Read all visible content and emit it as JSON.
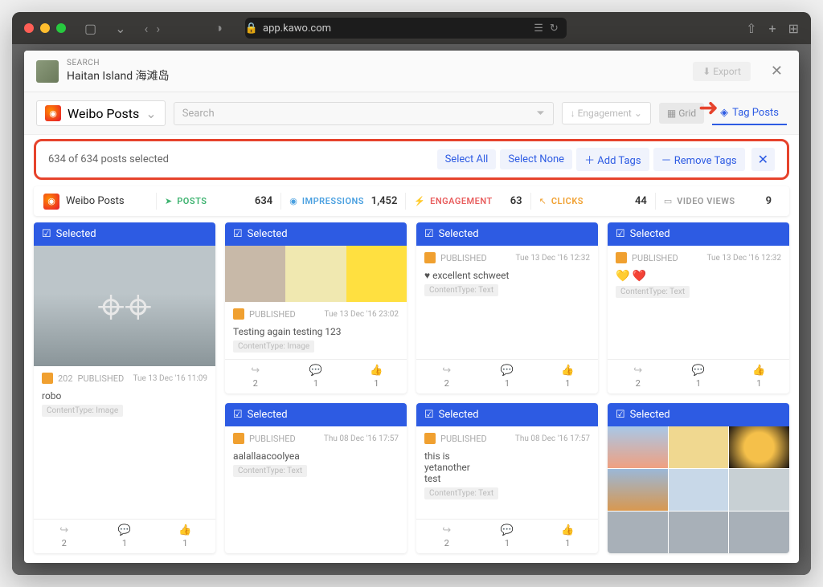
{
  "browser": {
    "url": "app.kawo.com"
  },
  "header": {
    "search_label": "SEARCH",
    "title": "Haitan Island 海滩岛",
    "export": "Export"
  },
  "toolbar": {
    "source": "Weibo Posts",
    "search_placeholder": "Search",
    "engagement": "Engagement",
    "grid": "Grid",
    "tag_posts": "Tag Posts"
  },
  "selection": {
    "count_text": "634 of 634 posts selected",
    "select_all": "Select All",
    "select_none": "Select None",
    "add_tags": "Add Tags",
    "remove_tags": "Remove Tags"
  },
  "stats": {
    "source": "Weibo Posts",
    "posts_label": "POSTS",
    "posts_val": "634",
    "impr_label": "IMPRESSIONS",
    "impr_val": "1,452",
    "eng_label": "ENGAGEMENT",
    "eng_val": "63",
    "clk_label": "CLICKS",
    "clk_val": "44",
    "vid_label": "VIDEO VIEWS",
    "vid_val": "9"
  },
  "labels": {
    "selected": "Selected",
    "published": "PUBLISHED",
    "ct_image": "ContentType: Image",
    "ct_text": "ContentType: Text"
  },
  "cards": [
    {
      "badge": "202",
      "date": "Tue 13 Dec '16 11:09",
      "body": "robo",
      "shares": "2",
      "comments": "1",
      "likes": "1"
    },
    {
      "date": "Tue 13 Dec '16 23:02",
      "body": "Testing again testing 123",
      "shares": "2",
      "comments": "1",
      "likes": "1"
    },
    {
      "date": "Thu 08 Dec '16 17:57",
      "body": "aalallaacoolyea"
    },
    {
      "date": "Tue 13 Dec '16 12:32",
      "body": "♥ excellent schweet",
      "shares": "2",
      "comments": "1",
      "likes": "1"
    },
    {
      "date": "Thu 08 Dec '16 17:57",
      "body": "this is\nyetanother\ntest",
      "shares": "2",
      "comments": "1",
      "likes": "1"
    },
    {
      "date": "Tue 13 Dec '16 12:32",
      "hearts": "💛 ❤️",
      "shares": "2",
      "comments": "1",
      "likes": "1"
    }
  ]
}
